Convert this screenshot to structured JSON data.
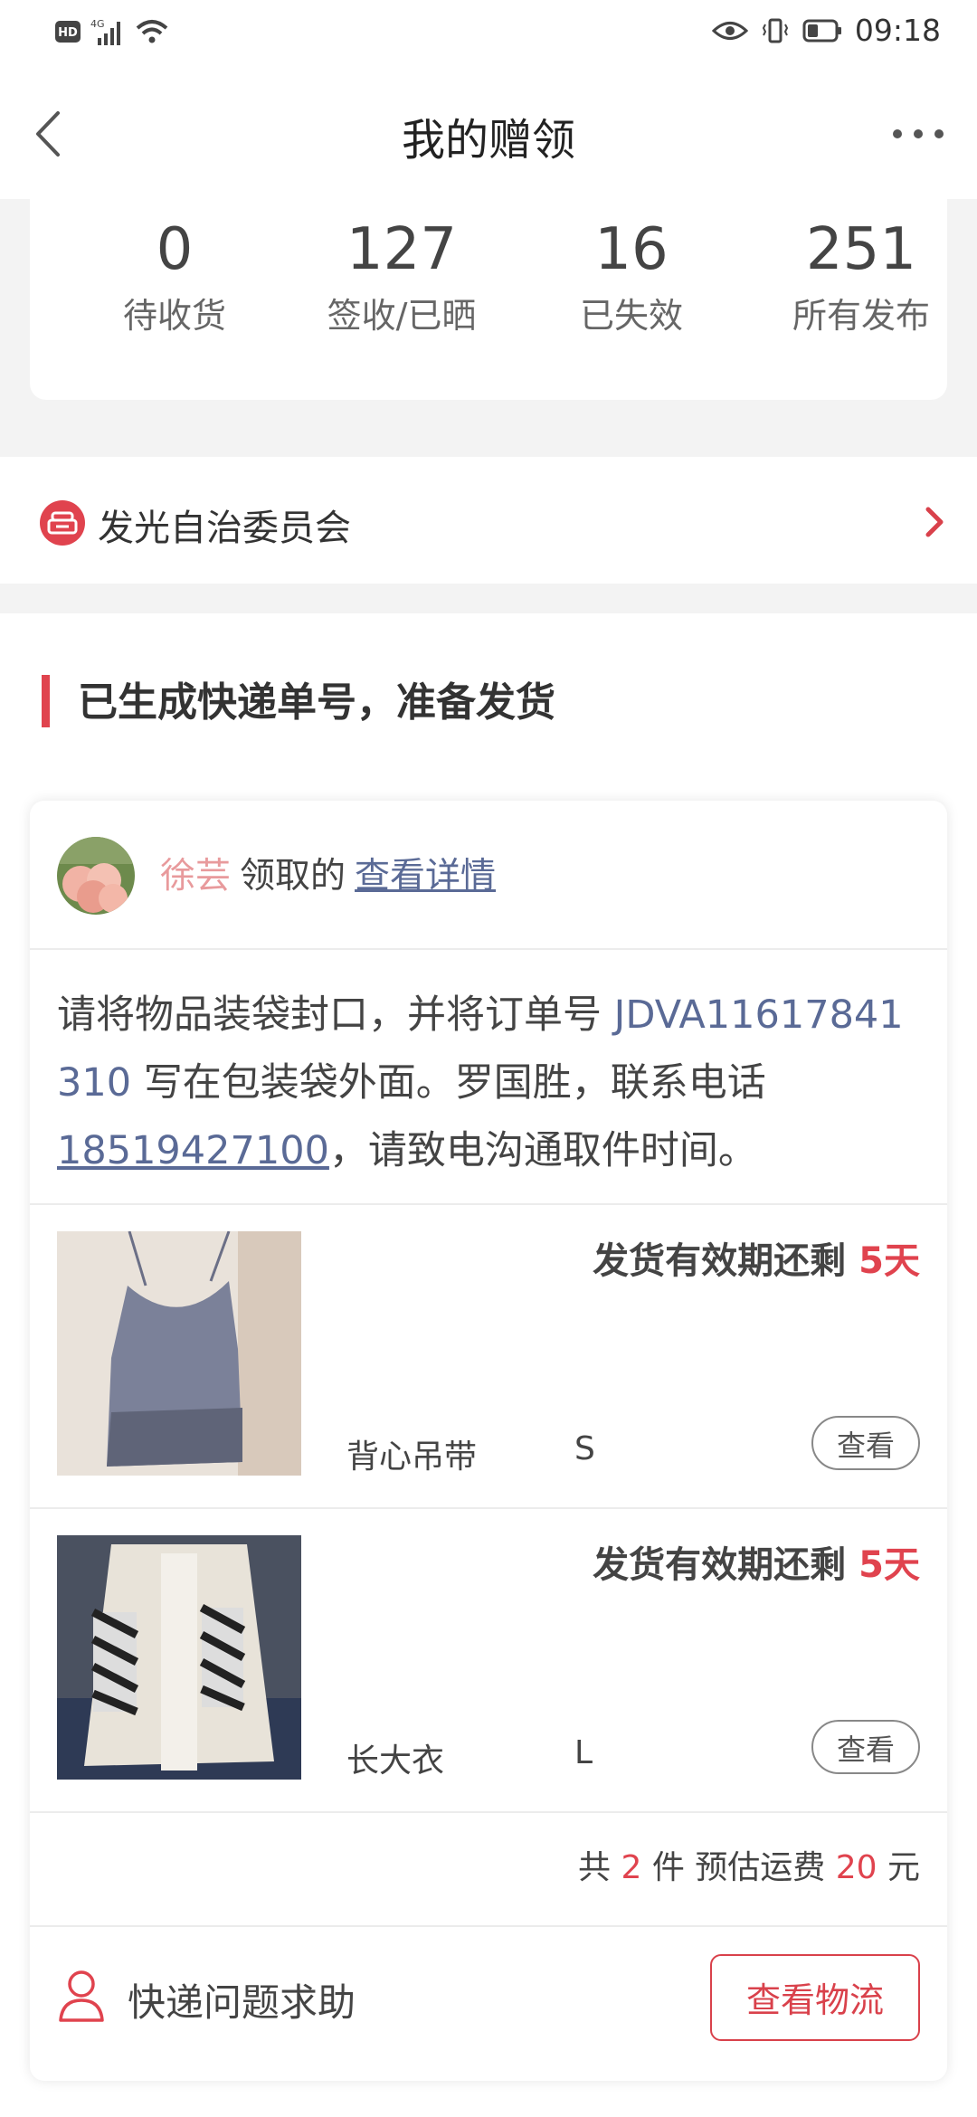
{
  "status_bar": {
    "time": "09:18",
    "left_icons": [
      "hd-icon",
      "4g-signal-icon",
      "wifi-icon"
    ],
    "right_icons": [
      "eye-icon",
      "vibrate-icon",
      "battery-icon"
    ]
  },
  "nav": {
    "title": "我的赠领"
  },
  "stats": [
    {
      "num": "0",
      "label": "待收货"
    },
    {
      "num": "127",
      "label": "签收/已晒"
    },
    {
      "num": "16",
      "label": "已失效"
    },
    {
      "num": "251",
      "label": "所有发布"
    }
  ],
  "org": {
    "label": "发光自治委员会"
  },
  "section": {
    "title": "已生成快递单号，准备发货"
  },
  "order": {
    "claimer_name": "徐芸",
    "claimer_action": "领取的",
    "detail_link": "查看详情",
    "instruction_1": "请将物品装袋封口，并将订单号 ",
    "order_number": "JDVA11617841310",
    "instruction_2": " 写在包装袋外面。罗国胜，联系电话",
    "phone": "18519427100",
    "instruction_3": "，请致电沟通取件时间。",
    "items": [
      {
        "deadline_label": "发货有效期还剩",
        "deadline_value": "5天",
        "name": "背心吊带",
        "size": "S",
        "view_label": "查看"
      },
      {
        "deadline_label": "发货有效期还剩",
        "deadline_value": "5天",
        "name": "长大衣",
        "size": "L",
        "view_label": "查看"
      }
    ],
    "summary": {
      "prefix": "共 ",
      "count": "2",
      "mid": " 件 预估运费 ",
      "fee": "20",
      "suffix": " 元"
    },
    "help_label": "快递问题求助",
    "track_label": "查看物流"
  },
  "colors": {
    "accent": "#e0434e",
    "link": "#5a6a96",
    "claimer": "#e89a9c"
  }
}
